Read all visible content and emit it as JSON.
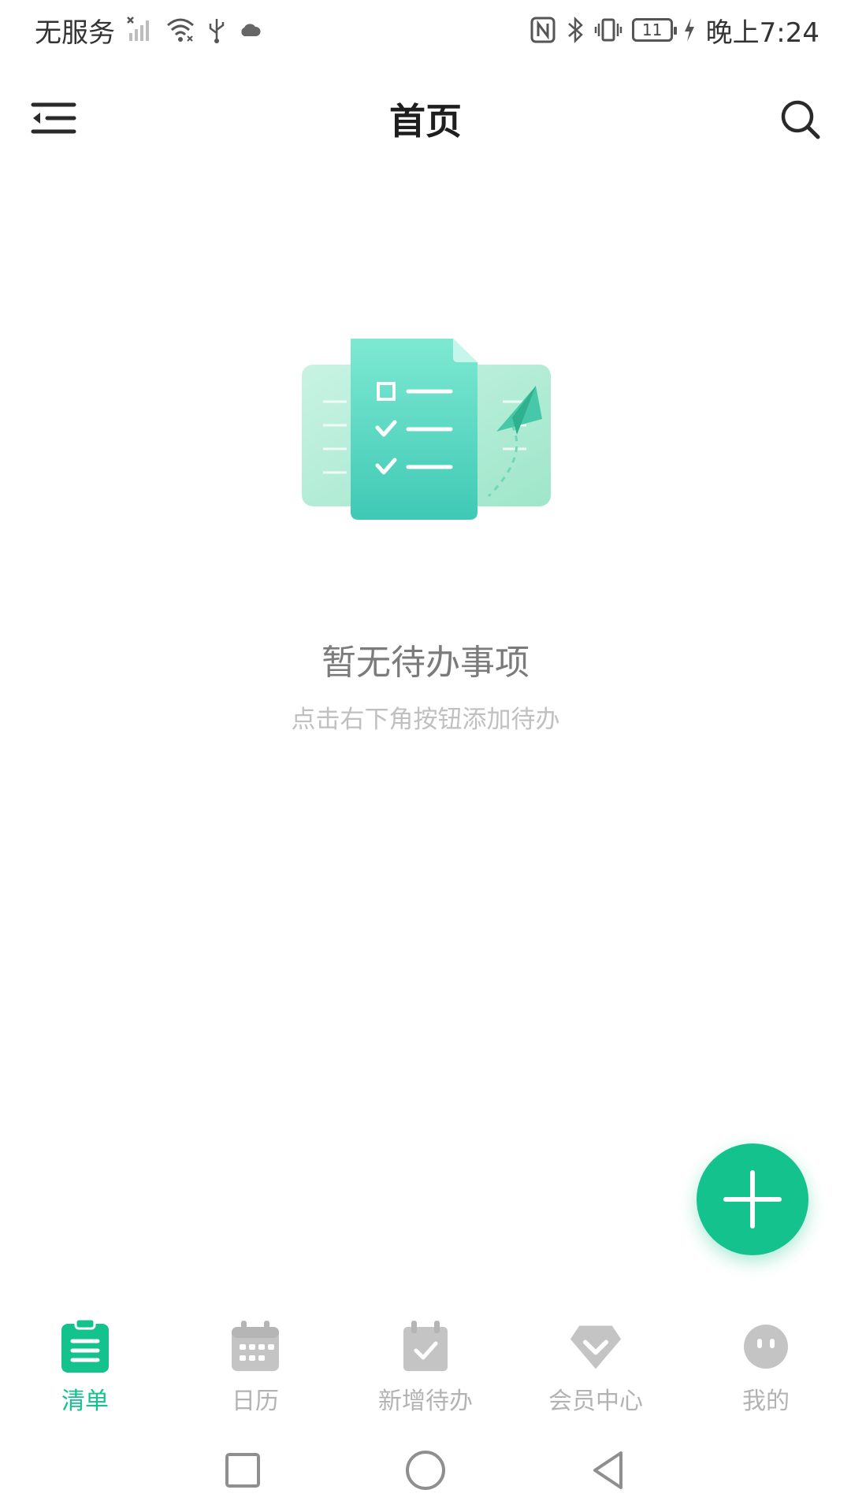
{
  "status_bar": {
    "carrier": "无服务",
    "battery": "11",
    "time": "晚上7:24",
    "icons": [
      "signal-off-icon",
      "wifi-icon",
      "usb-icon",
      "cloud-icon",
      "nfc-icon",
      "bluetooth-icon",
      "vibrate-icon",
      "battery-icon",
      "charging-icon"
    ]
  },
  "header": {
    "title": "首页",
    "menu_icon": "menu-collapse-icon",
    "search_icon": "search-icon"
  },
  "empty_state": {
    "illustration": "checklist-paper-plane-illustration",
    "title": "暂无待办事项",
    "subtitle": "点击右下角按钮添加待办"
  },
  "fab": {
    "icon": "plus-icon"
  },
  "tabs": [
    {
      "label": "清单",
      "icon": "clipboard-list-icon",
      "active": true
    },
    {
      "label": "日历",
      "icon": "calendar-icon",
      "active": false
    },
    {
      "label": "新增待办",
      "icon": "calendar-check-icon",
      "active": false
    },
    {
      "label": "会员中心",
      "icon": "diamond-icon",
      "active": false
    },
    {
      "label": "我的",
      "icon": "face-icon",
      "active": false
    }
  ],
  "colors": {
    "accent": "#13c28d",
    "inactive": "#b3b3b3",
    "title": "#1e1e1e",
    "empty_title": "#7b7b7b",
    "empty_subtitle": "#c0c0c0"
  },
  "system_nav": [
    "recents-button",
    "home-button",
    "back-button"
  ]
}
